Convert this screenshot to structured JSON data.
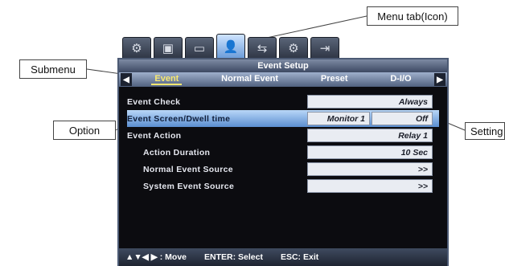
{
  "callouts": {
    "menu_tab": "Menu tab(Icon)",
    "submenu": "Submenu",
    "option": "Option",
    "setting": "Setting"
  },
  "tabs": [
    {
      "icon": "gear-icon",
      "glyph": "⚙"
    },
    {
      "icon": "monitor-icon",
      "glyph": "▣"
    },
    {
      "icon": "hdd-icon",
      "glyph": "▭"
    },
    {
      "icon": "user-icon",
      "glyph": "👤",
      "active": true
    },
    {
      "icon": "network-icon",
      "glyph": "⇆"
    },
    {
      "icon": "event-settings-icon",
      "glyph": "⚙"
    },
    {
      "icon": "exit-icon",
      "glyph": "⇥"
    }
  ],
  "panel": {
    "title": "Event Setup",
    "submenu": [
      "Event",
      "Normal Event",
      "Preset",
      "D-I/O"
    ],
    "rows": [
      {
        "label": "Event Check",
        "value": "Always"
      },
      {
        "label": "Event Screen/Dwell time",
        "value_left": "Monitor 1",
        "value_right": "Off"
      },
      {
        "label": "Event Action",
        "value": "Relay 1"
      },
      {
        "label": "Action Duration",
        "value": "10 Sec"
      },
      {
        "label": "Normal Event Source",
        "value": ">>"
      },
      {
        "label": "System Event Source",
        "value": ">>"
      }
    ],
    "footer": {
      "move": "▲▼◀ ▶ : Move",
      "select": "ENTER: Select",
      "exit": "ESC: Exit"
    }
  }
}
